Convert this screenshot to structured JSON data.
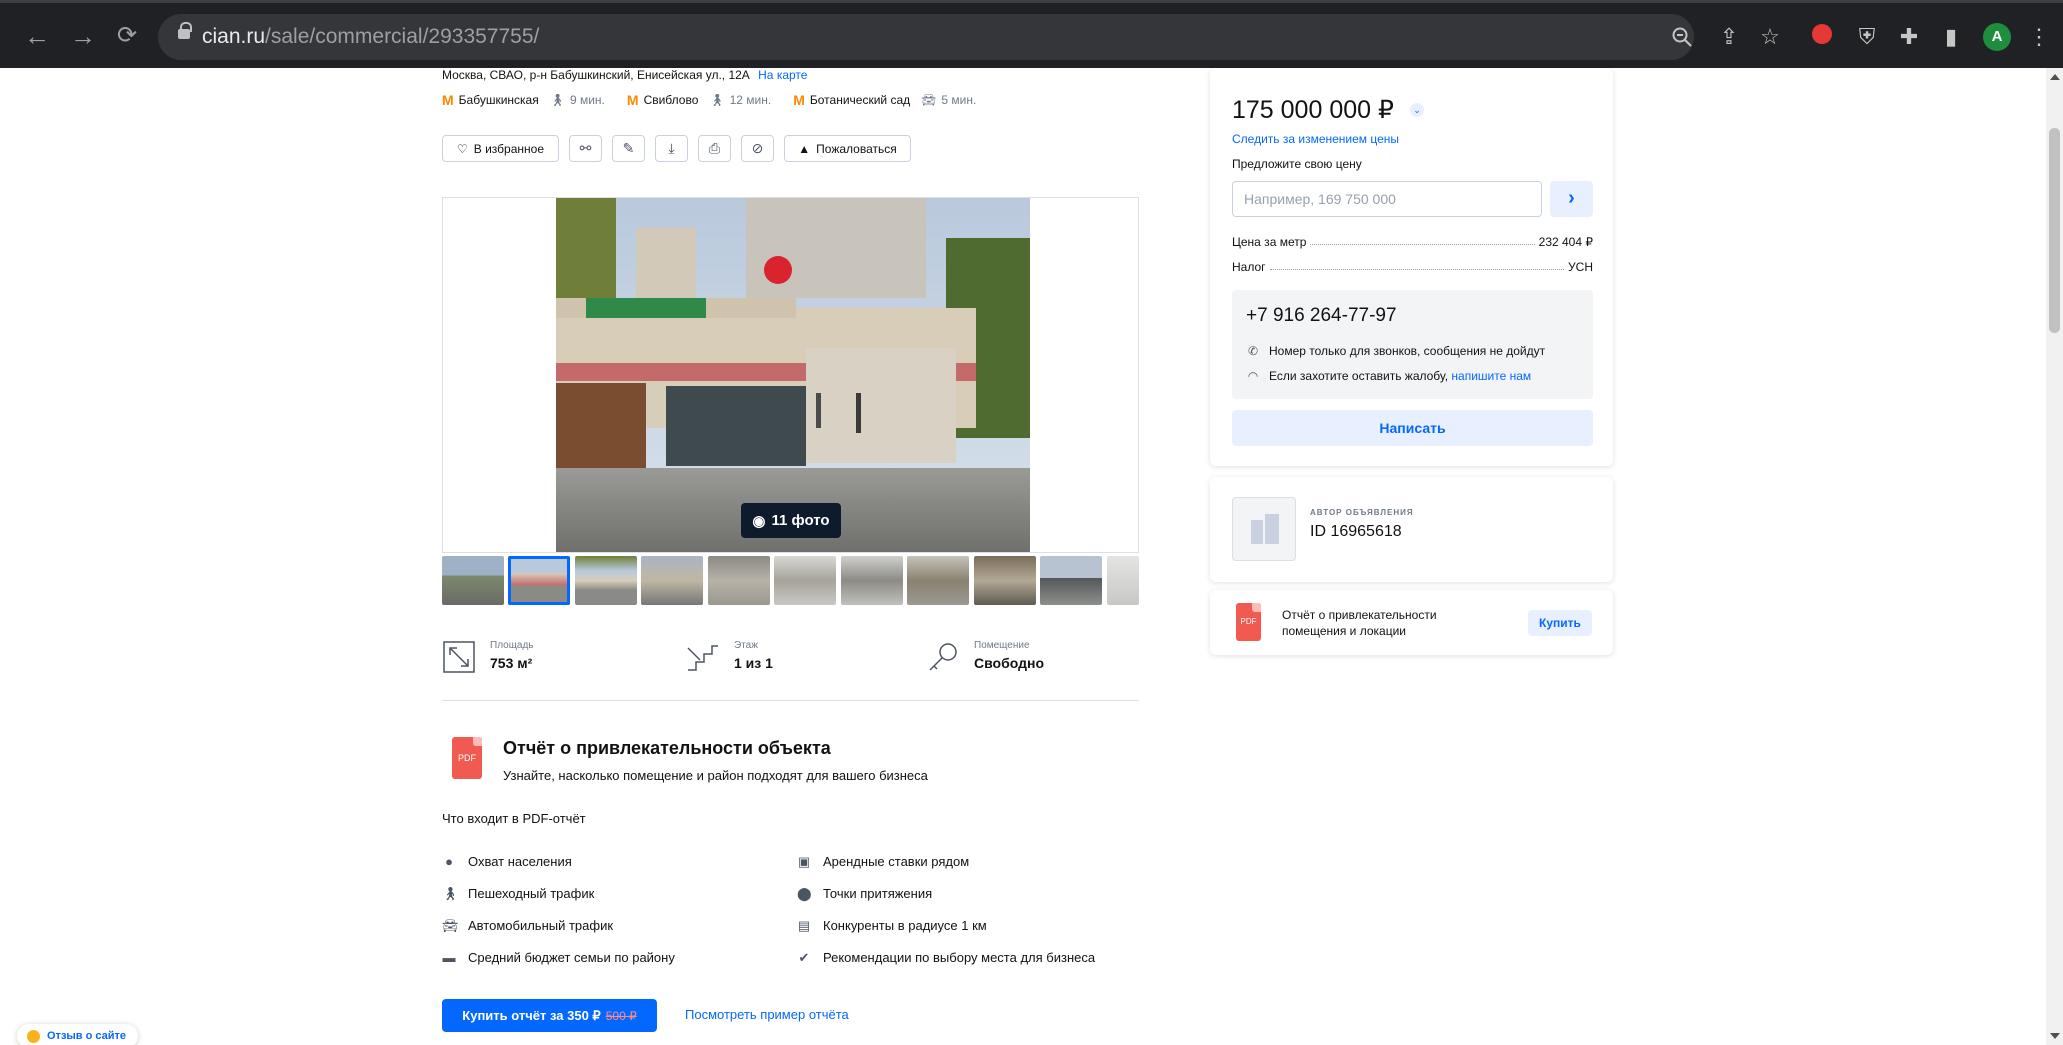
{
  "browser": {
    "url_host": "cian.ru",
    "url_path": "/sale/commercial/293357755/",
    "profile_initial": "A"
  },
  "listing": {
    "address": "Москва, СВАО, р-н Бабушкинский, Енисейская ул., 12А",
    "map_link": "На карте",
    "metro": [
      {
        "name": "Бабушкинская",
        "time": "9 мин.",
        "mode": "walk"
      },
      {
        "name": "Свиблово",
        "time": "12 мин.",
        "mode": "walk"
      },
      {
        "name": "Ботанический сад",
        "time": "5 мин.",
        "mode": "car"
      }
    ],
    "actions": {
      "favorite": "В избранное",
      "complain": "Пожаловаться"
    },
    "photo_count": "11 фото",
    "specs": [
      {
        "label": "Площадь",
        "value": "753 м²"
      },
      {
        "label": "Этаж",
        "value": "1 из 1"
      },
      {
        "label": "Помещение",
        "value": "Свободно"
      }
    ]
  },
  "report": {
    "pdf_badge": "PDF",
    "title": "Отчёт о привлекательности объекта",
    "subtitle": "Узнайте, насколько помещение и район подходят для вашего бизнеса",
    "includes_title": "Что входит в PDF-отчёт",
    "features_left": [
      "Охват населения",
      "Пешеходный трафик",
      "Автомобильный трафик",
      "Средний бюджет семьи по району"
    ],
    "features_right": [
      "Арендные ставки рядом",
      "Точки притяжения",
      "Конкуренты в радиусе 1 км",
      "Рекомендации по выбору места для бизнеса"
    ],
    "buy_label": "Купить отчёт за 350 ₽",
    "old_price": "500 ₽",
    "sample_link": "Посмотреть пример отчёта"
  },
  "feedback": {
    "label": "Отзыв о сайте"
  },
  "price_card": {
    "price": "175 000 000 ₽",
    "track_link": "Следить за изменением цены",
    "offer_label": "Предложите свою цену",
    "offer_placeholder": "Например, 169 750 000",
    "price_per_meter_label": "Цена за метр",
    "price_per_meter": "232 404 ₽",
    "tax_label": "Налог",
    "tax": "УСН",
    "phone": "+7 916 264-77-97",
    "phone_note": "Номер только для звонков, сообщения не дойдут",
    "complaint_text": "Если захотите оставить жалобу, ",
    "complaint_link": "напишите нам",
    "write_button": "Написать"
  },
  "author_card": {
    "label": "АВТОР ОБЪЯВЛЕНИЯ",
    "id": "ID 16965618"
  },
  "pdf_card": {
    "pdf_badge": "PDF",
    "text": "Отчёт о привлекательности помещения и локации",
    "buy_button": "Купить"
  }
}
